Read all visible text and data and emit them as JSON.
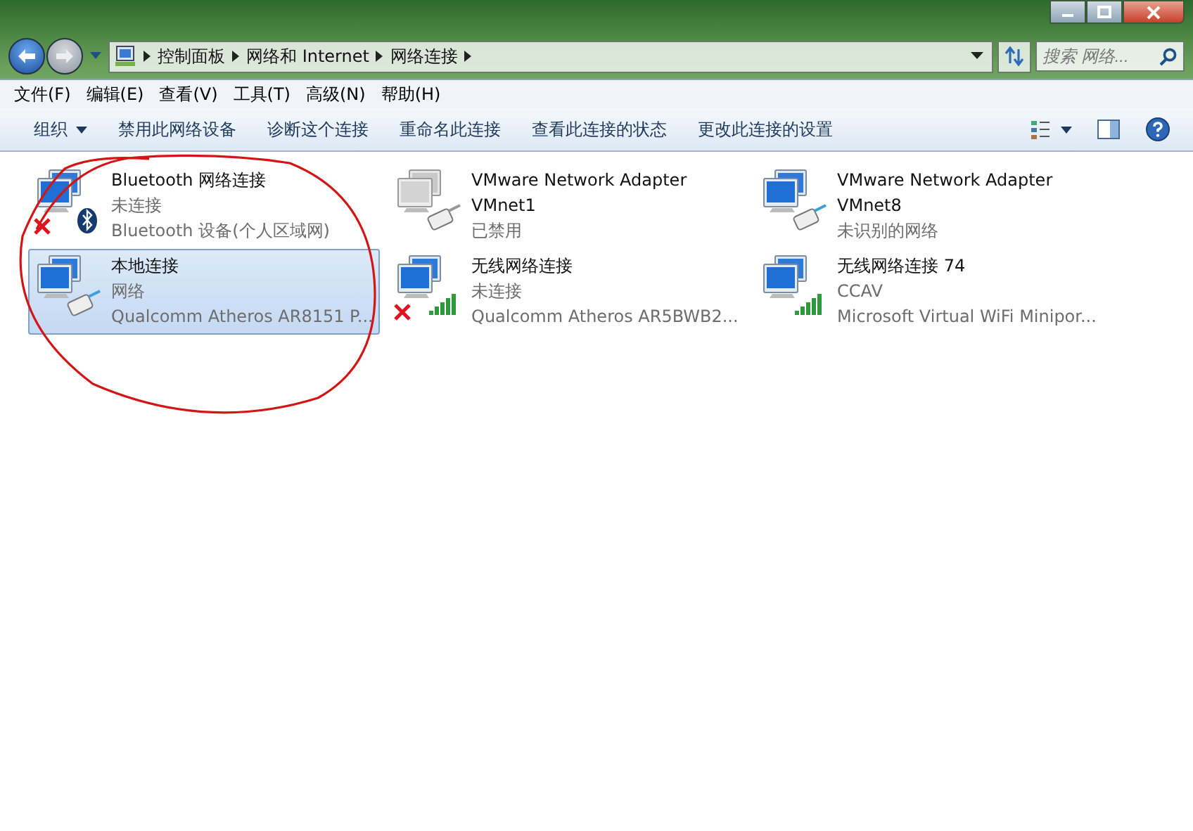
{
  "address_bar": {
    "breadcrumbs": [
      "控制面板",
      "网络和 Internet",
      "网络连接"
    ]
  },
  "search": {
    "placeholder": "搜索 网络..."
  },
  "menu": [
    "文件(F)",
    "编辑(E)",
    "查看(V)",
    "工具(T)",
    "高级(N)",
    "帮助(H)"
  ],
  "toolbar": {
    "organize": "组织",
    "buttons": [
      "禁用此网络设备",
      "诊断这个连接",
      "重命名此连接",
      "查看此连接的状态",
      "更改此连接的设置"
    ]
  },
  "connections": [
    {
      "kind": "bluetooth",
      "name": "Bluetooth 网络连接",
      "status": "未连接",
      "device": "Bluetooth 设备(个人区域网)",
      "disabled": false,
      "disconnected": true,
      "selected": false
    },
    {
      "kind": "ethernet",
      "name": "VMware Network Adapter VMnet1",
      "status": "已禁用",
      "disabled": true,
      "disconnected": false,
      "selected": false
    },
    {
      "kind": "ethernet",
      "name": "VMware Network Adapter VMnet8",
      "status": "未识别的网络",
      "disabled": false,
      "disconnected": false,
      "selected": false
    },
    {
      "kind": "ethernet",
      "name": "本地连接",
      "status": "网络",
      "device": "Qualcomm Atheros AR8151 P...",
      "disabled": false,
      "disconnected": false,
      "selected": true
    },
    {
      "kind": "wifi",
      "name": "无线网络连接",
      "status": "未连接",
      "device": "Qualcomm Atheros AR5BWB2...",
      "disabled": false,
      "disconnected": true,
      "selected": false
    },
    {
      "kind": "wifi",
      "name": "无线网络连接 74",
      "status": "CCAV",
      "device": "Microsoft Virtual WiFi Minipor...",
      "disabled": false,
      "disconnected": false,
      "selected": false
    }
  ]
}
